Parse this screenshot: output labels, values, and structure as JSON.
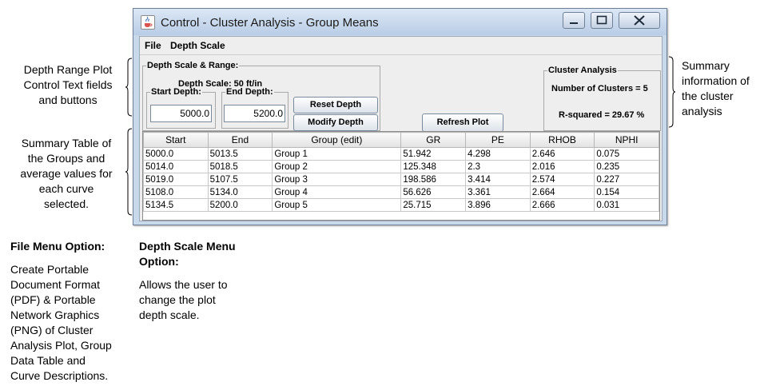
{
  "window": {
    "title": "Control - Cluster Analysis - Group Means",
    "menu": [
      "File",
      "Depth Scale"
    ]
  },
  "depth_panel": {
    "legend": "Depth Scale & Range:",
    "scale_text": "Depth Scale: 50 ft/in",
    "start_label": "Start Depth:",
    "start_value": "5000.0",
    "end_label": "End Depth:",
    "end_value": "5200.0",
    "reset_label": "Reset Depth",
    "modify_label": "Modify Depth"
  },
  "refresh_label": "Refresh Plot",
  "cluster_panel": {
    "legend": "Cluster Analysis",
    "num_clusters": "Number of Clusters = 5",
    "r_squared": "R-squared = 29.67 %"
  },
  "table": {
    "columns": [
      "Start",
      "End",
      "Group (edit)",
      "GR",
      "PE",
      "RHOB",
      "NPHI"
    ],
    "rows": [
      [
        "5000.0",
        "5013.5",
        "Group 1",
        "51.942",
        "4.298",
        "2.646",
        "0.075"
      ],
      [
        "5014.0",
        "5018.5",
        "Group 2",
        "125.348",
        "2.3",
        "2.016",
        "0.235"
      ],
      [
        "5019.0",
        "5107.5",
        "Group 3",
        "198.586",
        "3.414",
        "2.574",
        "0.227"
      ],
      [
        "5108.0",
        "5134.0",
        "Group 4",
        "56.626",
        "3.361",
        "2.664",
        "0.154"
      ],
      [
        "5134.5",
        "5200.0",
        "Group 5",
        "25.715",
        "3.896",
        "2.666",
        "0.031"
      ]
    ]
  },
  "annotations": {
    "depth_controls": [
      "Depth Range Plot",
      "Control Text fields",
      "and buttons"
    ],
    "summary_table": [
      "Summary Table of",
      "the Groups and",
      "average values for",
      "each curve",
      "selected."
    ],
    "summary_info": [
      "Summary",
      "information of",
      "the cluster",
      "analysis"
    ],
    "file_menu_title": "File Menu Option:",
    "file_menu_desc": [
      "Create Portable",
      "Document Format",
      "(PDF) & Portable",
      "Network Graphics",
      "(PNG) of Cluster",
      "Analysis Plot, Group",
      "Data Table and",
      "Curve Descriptions."
    ],
    "depth_menu_title": [
      "Depth Scale Menu",
      "Option:"
    ],
    "depth_menu_desc": [
      "Allows the user to",
      "change the plot",
      "depth scale."
    ]
  }
}
